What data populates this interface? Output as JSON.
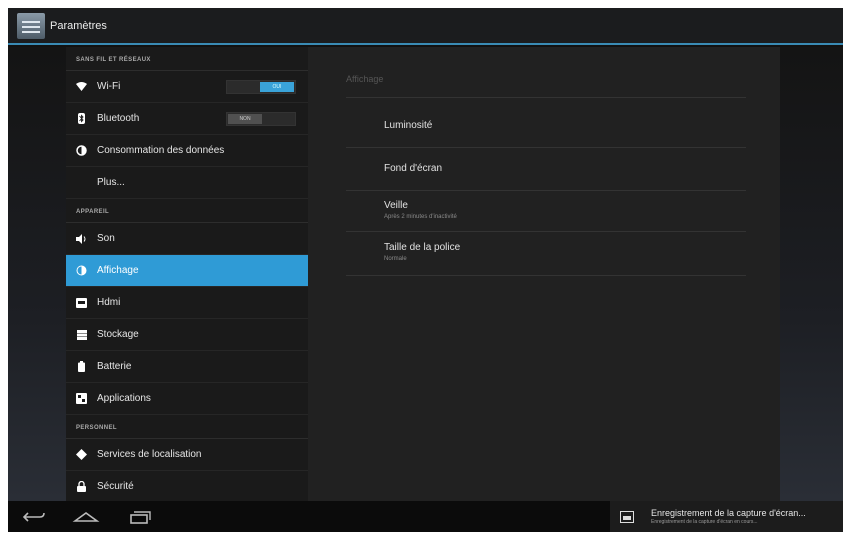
{
  "actionbar": {
    "title": "Paramètres"
  },
  "sections": {
    "wireless": "SANS FIL ET RÉSEAUX",
    "device": "APPAREIL",
    "personal": "PERSONNEL"
  },
  "items": {
    "wifi": {
      "label": "Wi-Fi",
      "toggle": "OUI"
    },
    "bluetooth": {
      "label": "Bluetooth",
      "toggle": "NON"
    },
    "data": {
      "label": "Consommation des données"
    },
    "more": {
      "label": "Plus..."
    },
    "sound": {
      "label": "Son"
    },
    "display": {
      "label": "Affichage"
    },
    "hdmi": {
      "label": "Hdmi"
    },
    "storage": {
      "label": "Stockage"
    },
    "battery": {
      "label": "Batterie"
    },
    "apps": {
      "label": "Applications"
    },
    "location": {
      "label": "Services de localisation"
    },
    "security": {
      "label": "Sécurité"
    }
  },
  "detail": {
    "header": "Affichage",
    "brightness": {
      "title": "Luminosité"
    },
    "wallpaper": {
      "title": "Fond d'écran"
    },
    "sleep": {
      "title": "Veille",
      "summary": "Après 2 minutes d'inactivité"
    },
    "font_size": {
      "title": "Taille de la police",
      "summary": "Normale"
    }
  },
  "notification": {
    "title": "Enregistrement de la capture d'écran...",
    "subtitle": "Enregistrement de la capture d'écran en cours..."
  },
  "icons": {
    "back": "back-icon",
    "home": "home-icon",
    "recents": "recents-icon",
    "wifi": "wifi-icon",
    "bluetooth": "bluetooth-icon",
    "data": "data-usage-icon",
    "sound": "sound-icon",
    "display": "display-icon",
    "hdmi": "hdmi-icon",
    "storage": "storage-icon",
    "battery": "battery-icon",
    "apps": "apps-icon",
    "location": "location-icon",
    "security": "lock-icon",
    "screenshot": "image-icon"
  },
  "colors": {
    "accent": "#2f9bd6",
    "toggle_on": "#3aa3d9"
  }
}
